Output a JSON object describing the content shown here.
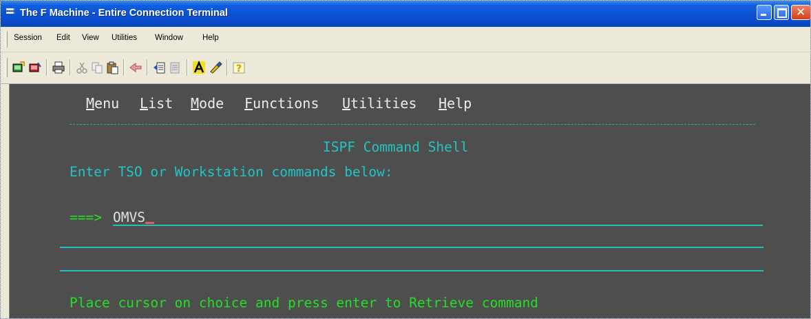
{
  "window": {
    "title": "The F Machine - Entire Connection Terminal"
  },
  "menubar": {
    "items": [
      "Session",
      "Edit",
      "View",
      "Utilities",
      "Window",
      "Help"
    ]
  },
  "toolbar": {
    "icons": [
      "connect-icon",
      "disconnect-icon",
      "print-icon",
      "cut-icon",
      "copy-icon",
      "paste-icon",
      "transfer-icon",
      "upload-icon",
      "download-icon",
      "font-icon",
      "color-icon",
      "help-icon"
    ]
  },
  "terminal": {
    "menu": [
      {
        "hot": "M",
        "rest": "enu"
      },
      {
        "hot": "L",
        "rest": "ist"
      },
      {
        "hot": "M",
        "rest": "ode"
      },
      {
        "hot": "F",
        "rest": "unctions"
      },
      {
        "hot": "U",
        "rest": "tilities"
      },
      {
        "hot": "H",
        "rest": "elp"
      }
    ],
    "heading": "ISPF Command Shell",
    "instruction": "Enter TSO or Workstation commands below:",
    "prompt": "===>",
    "command_value": "OMVS",
    "footer": "Place cursor on choice and press enter to Retrieve command"
  },
  "colors": {
    "terminal_bg": "#4e4e4e",
    "cyan": "#22c5c5",
    "green": "#22e022",
    "titlebar": "#0a4fd0"
  }
}
